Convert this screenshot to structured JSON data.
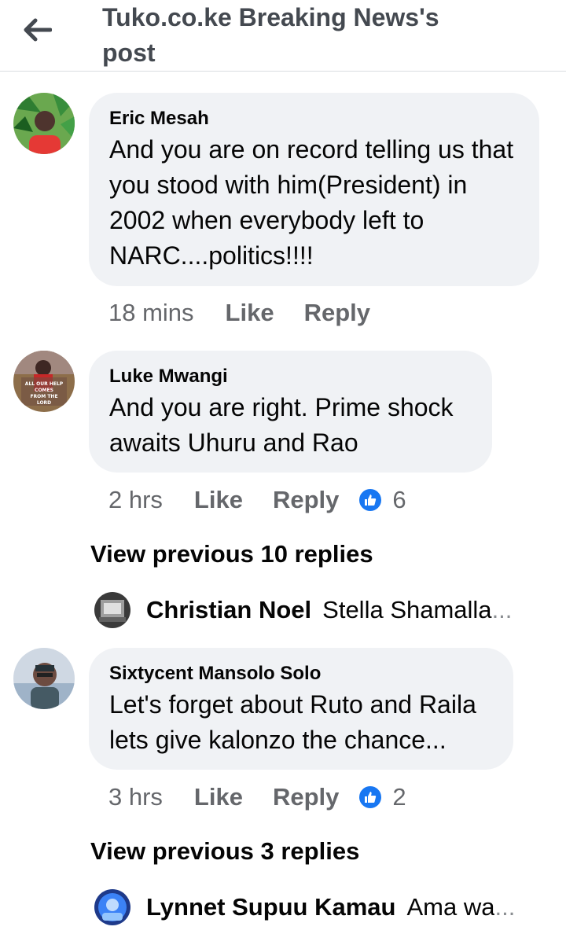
{
  "header": {
    "title": "Tuko.co.ke Breaking News's post"
  },
  "comments": [
    {
      "author": "Eric Mesah",
      "text": "And you are on record telling us that you stood with him(President) in 2002 when everybody left to NARC....politics!!!!",
      "time": "18 mins",
      "like_label": "Like",
      "reply_label": "Reply"
    },
    {
      "author": "Luke Mwangi",
      "avatar_caption": "ALL OUR HELP COMES FROM THE LORD",
      "text": "And you are right. Prime shock awaits Uhuru and Rao",
      "time": "2 hrs",
      "like_label": "Like",
      "reply_label": "Reply",
      "reaction_count": "6",
      "view_previous": "View previous 10 replies",
      "reply_preview": {
        "name": "Christian Noel",
        "text": "Stella Shamalla",
        "ellipsis": "..."
      }
    },
    {
      "author": "Sixtycent Mansolo Solo",
      "text": "Let's forget about Ruto and Raila lets give kalonzo the chance...",
      "time": "3 hrs",
      "like_label": "Like",
      "reply_label": "Reply",
      "reaction_count": "2",
      "view_previous": "View previous 3 replies",
      "reply_preview": {
        "name": "Lynnet Supuu Kamau",
        "text": "Ama wa",
        "ellipsis": "..."
      }
    }
  ],
  "colors": {
    "bubble": "#f0f2f5",
    "meta": "#65676b",
    "like_blue": "#1877f2"
  },
  "icons": {
    "back": "arrow-left-icon",
    "reaction": "thumbs-up-icon"
  }
}
